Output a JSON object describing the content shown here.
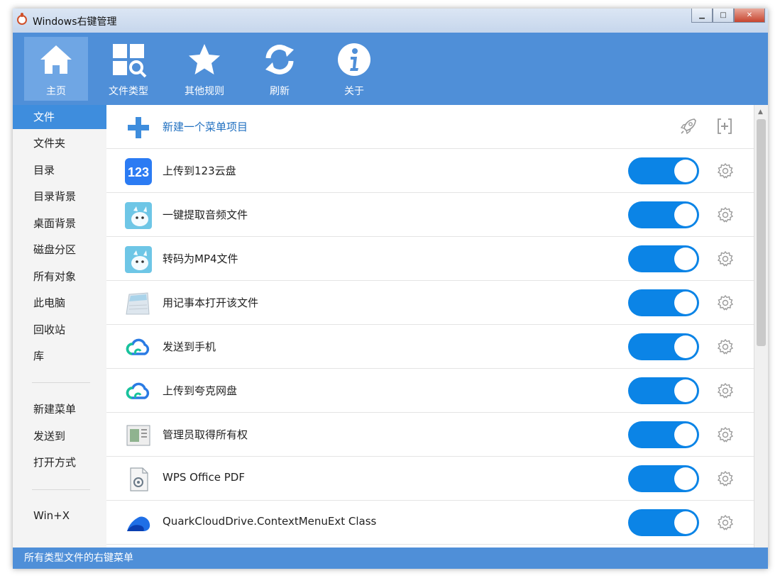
{
  "window": {
    "title": "Windows右键管理"
  },
  "toolbar": {
    "items": [
      {
        "label": "主页",
        "icon": "home-icon",
        "active": true
      },
      {
        "label": "文件类型",
        "icon": "file-types-icon"
      },
      {
        "label": "其他规则",
        "icon": "star-icon"
      },
      {
        "label": "刷新",
        "icon": "refresh-icon"
      },
      {
        "label": "关于",
        "icon": "info-icon"
      }
    ]
  },
  "sidebar": {
    "items": [
      {
        "label": "文件",
        "active": true
      },
      {
        "label": "文件夹"
      },
      {
        "label": "目录"
      },
      {
        "label": "目录背景"
      },
      {
        "label": "桌面背景"
      },
      {
        "label": "磁盘分区"
      },
      {
        "label": "所有对象"
      },
      {
        "label": "此电脑"
      },
      {
        "label": "回收站"
      },
      {
        "label": "库"
      },
      {
        "label": "新建菜单"
      },
      {
        "label": "发送到"
      },
      {
        "label": "打开方式"
      },
      {
        "label": "Win+X"
      }
    ]
  },
  "main": {
    "new_item_label": "新建一个菜单项目",
    "rows": [
      {
        "label": "上传到123云盘",
        "icon": "123pan-icon",
        "enabled": true
      },
      {
        "label": "一键提取音频文件",
        "icon": "audio-extract-icon",
        "enabled": true
      },
      {
        "label": "转码为MP4文件",
        "icon": "mp4-convert-icon",
        "enabled": true
      },
      {
        "label": "用记事本打开该文件",
        "icon": "notepad-icon",
        "enabled": true
      },
      {
        "label": "发送到手机",
        "icon": "cloud-icon",
        "enabled": true
      },
      {
        "label": "上传到夸克网盘",
        "icon": "cloud-icon",
        "enabled": true
      },
      {
        "label": "管理员取得所有权",
        "icon": "admin-ownership-icon",
        "enabled": true
      },
      {
        "label": "WPS Office PDF",
        "icon": "wps-pdf-icon",
        "enabled": true
      },
      {
        "label": "QuarkCloudDrive.ContextMenuExt Class",
        "icon": "quark-icon",
        "enabled": true
      }
    ]
  },
  "statusbar": {
    "text": "所有类型文件的右键菜单"
  },
  "colors": {
    "accent": "#4f8fd8",
    "toggle_on": "#0b84e6",
    "sidebar_active": "#3e8ddd"
  }
}
